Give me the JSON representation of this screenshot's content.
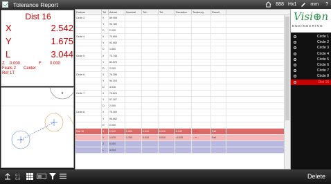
{
  "titlebar": {
    "title": "Tolerance Report",
    "unit1": "888",
    "unit2": "Hx1",
    "unit3": "mm",
    "help": "?"
  },
  "dro": {
    "title": "Dist 16",
    "x_label": "X",
    "x_value": "2.542",
    "y_label": "Y",
    "y_value": "1.675",
    "l_label": "L",
    "l_value": "3.044",
    "z_label": "Z",
    "z_value": "0.000",
    "f_label": "F",
    "f_value": "0.000",
    "feats": "Feats 2",
    "center": "Center",
    "ref": "Ref 1T"
  },
  "table": {
    "headers": [
      "Feature",
      "Tol",
      "Actual",
      "Nominal",
      "Tol+",
      "Tol-",
      "Deviation",
      "Tendency",
      "Result"
    ],
    "rows": [
      {
        "feature": "Circle 3",
        "tol": "X",
        "actual": "89.008",
        "style": ""
      },
      {
        "feature": "",
        "tol": "Y",
        "actual": "90.783",
        "style": ""
      },
      {
        "feature": "",
        "tol": "D",
        "actual": "2.009",
        "style": ""
      },
      {
        "feature": "Circle 4",
        "tol": "X",
        "actual": "70.806",
        "style": ""
      },
      {
        "feature": "",
        "tol": "Y",
        "actual": "93.063",
        "style": ""
      },
      {
        "feature": "",
        "tol": "D",
        "actual": "1.664",
        "style": ""
      },
      {
        "feature": "Circle 5",
        "tol": "X",
        "actual": "73.746",
        "style": ""
      },
      {
        "feature": "",
        "tol": "Y",
        "actual": "82.876",
        "style": ""
      },
      {
        "feature": "",
        "tol": "D",
        "actual": "2.000",
        "style": ""
      },
      {
        "feature": "Circle 6",
        "tol": "X",
        "actual": "76.286",
        "style": ""
      },
      {
        "feature": "",
        "tol": "Y",
        "actual": "94.203",
        "style": ""
      },
      {
        "feature": "",
        "tol": "D",
        "actual": "3.516",
        "style": ""
      },
      {
        "feature": "Circle 7",
        "tol": "X",
        "actual": "76.824",
        "style": ""
      },
      {
        "feature": "",
        "tol": "Y",
        "actual": "97.307",
        "style": ""
      },
      {
        "feature": "",
        "tol": "D",
        "actual": "2.000",
        "style": ""
      },
      {
        "feature": "Circle 8",
        "tol": "X",
        "actual": "75.300",
        "style": ""
      },
      {
        "feature": "",
        "tol": "Y",
        "actual": "96.662",
        "style": ""
      },
      {
        "feature": "",
        "tol": "D",
        "actual": "2.000",
        "style": ""
      },
      {
        "feature": "Dist 16",
        "tol": "X",
        "actual": "2.542",
        "nominal": "2.500",
        "tolp": "0.010",
        "toln": "0.010",
        "dev": "0.042",
        "result": "Fail",
        "style": "redrow"
      },
      {
        "feature": "",
        "tol": "Y",
        "actual": "1.675",
        "nominal": "1.700",
        "tolp": "0.010",
        "toln": "0.010",
        "dev": "-0.025",
        "result": "Fail",
        "style": "pinkrow"
      },
      {
        "feature": "",
        "tol": "Z",
        "actual": "0.000",
        "style": "bluerow"
      },
      {
        "feature": "",
        "tol": "L",
        "actual": "3.044",
        "style": "bluerow"
      }
    ]
  },
  "logo": {
    "brand": "Visi⊕n",
    "tagline": "ENGINEERING"
  },
  "features": [
    {
      "name": "Circle 1"
    },
    {
      "name": "Circle 2"
    },
    {
      "name": "Circle 3"
    },
    {
      "name": "Circle 4"
    },
    {
      "name": "Circle 5"
    },
    {
      "name": "Circle 6"
    },
    {
      "name": "Circle 7"
    },
    {
      "name": "Circle 8"
    },
    {
      "name": "Dist 16"
    }
  ],
  "bottom": {
    "delete_label": "Delete"
  },
  "colors": {
    "dro_red": "#cc0000",
    "fail_row": "#d86a6a",
    "selected_feature": "#c80000",
    "brand_green": "#2a8f4a"
  }
}
